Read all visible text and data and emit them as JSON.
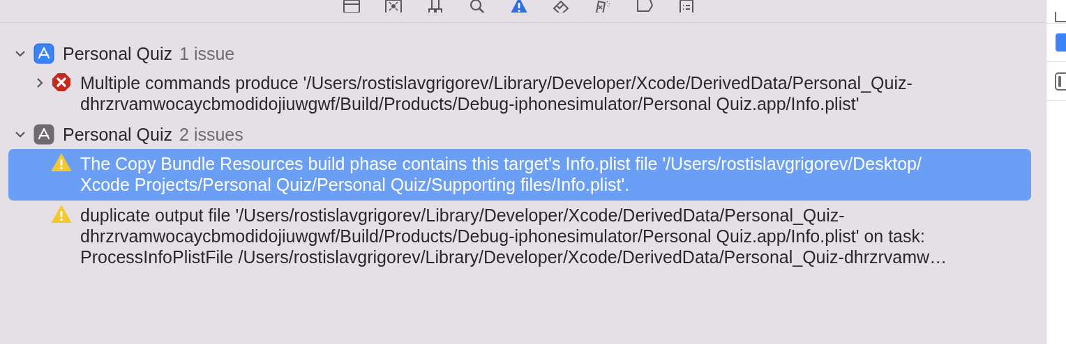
{
  "navigator_tabs": [
    {
      "kind": "folder",
      "selected": false
    },
    {
      "kind": "source-control",
      "selected": false
    },
    {
      "kind": "hierarchy",
      "selected": false
    },
    {
      "kind": "search",
      "selected": false
    },
    {
      "kind": "issue",
      "selected": true
    },
    {
      "kind": "test",
      "selected": false
    },
    {
      "kind": "debug",
      "selected": false
    },
    {
      "kind": "breakpoint",
      "selected": false
    },
    {
      "kind": "report",
      "selected": false
    }
  ],
  "groups": [
    {
      "title": "Personal Quiz",
      "count": "1 issue",
      "expanded": true,
      "active": true,
      "issues": [
        {
          "kind": "error",
          "expanded": false,
          "selected": false,
          "lines": [
            "Multiple commands produce '/Users/rostislavgrigorev/Library/Developer/Xcode/DerivedData/Personal_Quiz-",
            "dhrzrvamwocaycbmodidojiuwgwf/Build/Products/Debug-iphonesimulator/Personal Quiz.app/Info.plist'"
          ]
        }
      ]
    },
    {
      "title": "Personal Quiz",
      "count": "2 issues",
      "expanded": true,
      "active": false,
      "issues": [
        {
          "kind": "warning",
          "selected": true,
          "lines": [
            "The Copy Bundle Resources build phase contains this target's Info.plist file '/Users/rostislavgrigorev/Desktop/",
            "Xcode Projects/Personal Quiz/Personal Quiz/Supporting files/Info.plist'."
          ]
        },
        {
          "kind": "warning",
          "selected": false,
          "lines": [
            "duplicate output file '/Users/rostislavgrigorev/Library/Developer/Xcode/DerivedData/Personal_Quiz-",
            "dhrzrvamwocaycbmodidojiuwgwf/Build/Products/Debug-iphonesimulator/Personal Quiz.app/Info.plist' on task:",
            "ProcessInfoPlistFile /Users/rostislavgrigorev/Library/Developer/Xcode/DerivedData/Personal_Quiz-dhrzrvamw…"
          ]
        }
      ]
    }
  ]
}
